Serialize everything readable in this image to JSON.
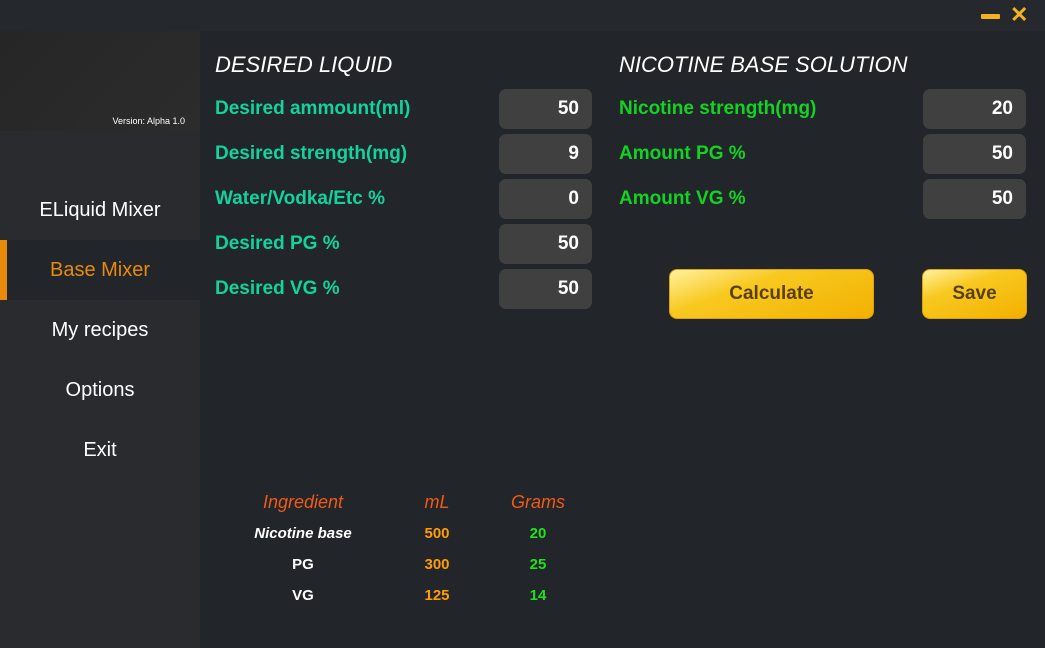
{
  "window": {
    "minimize_icon": "minimize-icon",
    "close_icon": "close-icon"
  },
  "sidebar": {
    "version": "Version: Alpha 1.0",
    "items": [
      {
        "label": "ELiquid Mixer"
      },
      {
        "label": "Base Mixer",
        "active": true
      },
      {
        "label": "My recipes"
      },
      {
        "label": "Options"
      },
      {
        "label": "Exit"
      }
    ]
  },
  "desired": {
    "title": "DESIRED LIQUID",
    "fields": [
      {
        "label": "Desired ammount(ml)",
        "value": "50"
      },
      {
        "label": "Desired strength(mg)",
        "value": "9"
      },
      {
        "label": "Water/Vodka/Etc %",
        "value": "0"
      },
      {
        "label": "Desired PG %",
        "value": "50"
      },
      {
        "label": "Desired VG %",
        "value": "50"
      }
    ]
  },
  "base": {
    "title": "NICOTINE BASE SOLUTION",
    "fields": [
      {
        "label": "Nicotine strength(mg)",
        "value": "20"
      },
      {
        "label": "Amount PG %",
        "value": "50"
      },
      {
        "label": "Amount VG %",
        "value": "50"
      }
    ]
  },
  "buttons": {
    "calculate": "Calculate",
    "save": "Save"
  },
  "results": {
    "headers": [
      "Ingredient",
      "mL",
      "Grams"
    ],
    "rows": [
      {
        "name": "Nicotine base",
        "ml": "500",
        "grams": "20"
      },
      {
        "name": "PG",
        "ml": "300",
        "grams": "25"
      },
      {
        "name": "VG",
        "ml": "125",
        "grams": "14"
      }
    ]
  },
  "colors": {
    "accent": "#e88a0c",
    "teal": "#12d39b",
    "green": "#12d323",
    "button": "#f8c921"
  }
}
